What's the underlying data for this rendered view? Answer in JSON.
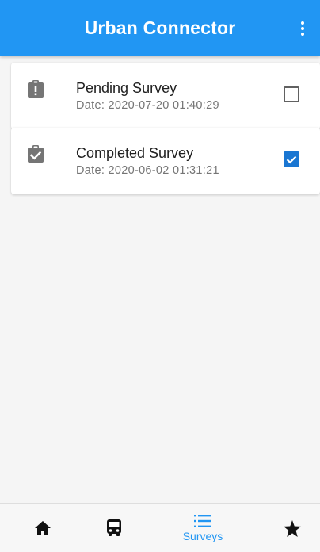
{
  "app_bar": {
    "title": "Urban Connector",
    "background": "#2196f3",
    "menu_icon": "more-vert-icon"
  },
  "surveys": [
    {
      "title": "Pending Survey",
      "date": "Date: 2020-07-20 01:40:29",
      "icon": "clipboard-alert-icon",
      "checked": false
    },
    {
      "title": "Completed Survey",
      "date": "Date: 2020-06-02 01:31:21",
      "icon": "clipboard-check-icon",
      "checked": true
    }
  ],
  "bottom_nav": {
    "items": [
      {
        "id": "home",
        "icon": "home-icon",
        "label": ""
      },
      {
        "id": "transit",
        "icon": "bus-icon",
        "label": ""
      },
      {
        "id": "surveys",
        "icon": "list-icon",
        "label": "Surveys",
        "active": true
      },
      {
        "id": "favorites",
        "icon": "star-icon",
        "label": ""
      }
    ],
    "active_color": "#2196f3"
  },
  "colors": {
    "accent": "#2196f3",
    "checkbox_checked": "#1976d2",
    "icon_gray": "#757575"
  }
}
